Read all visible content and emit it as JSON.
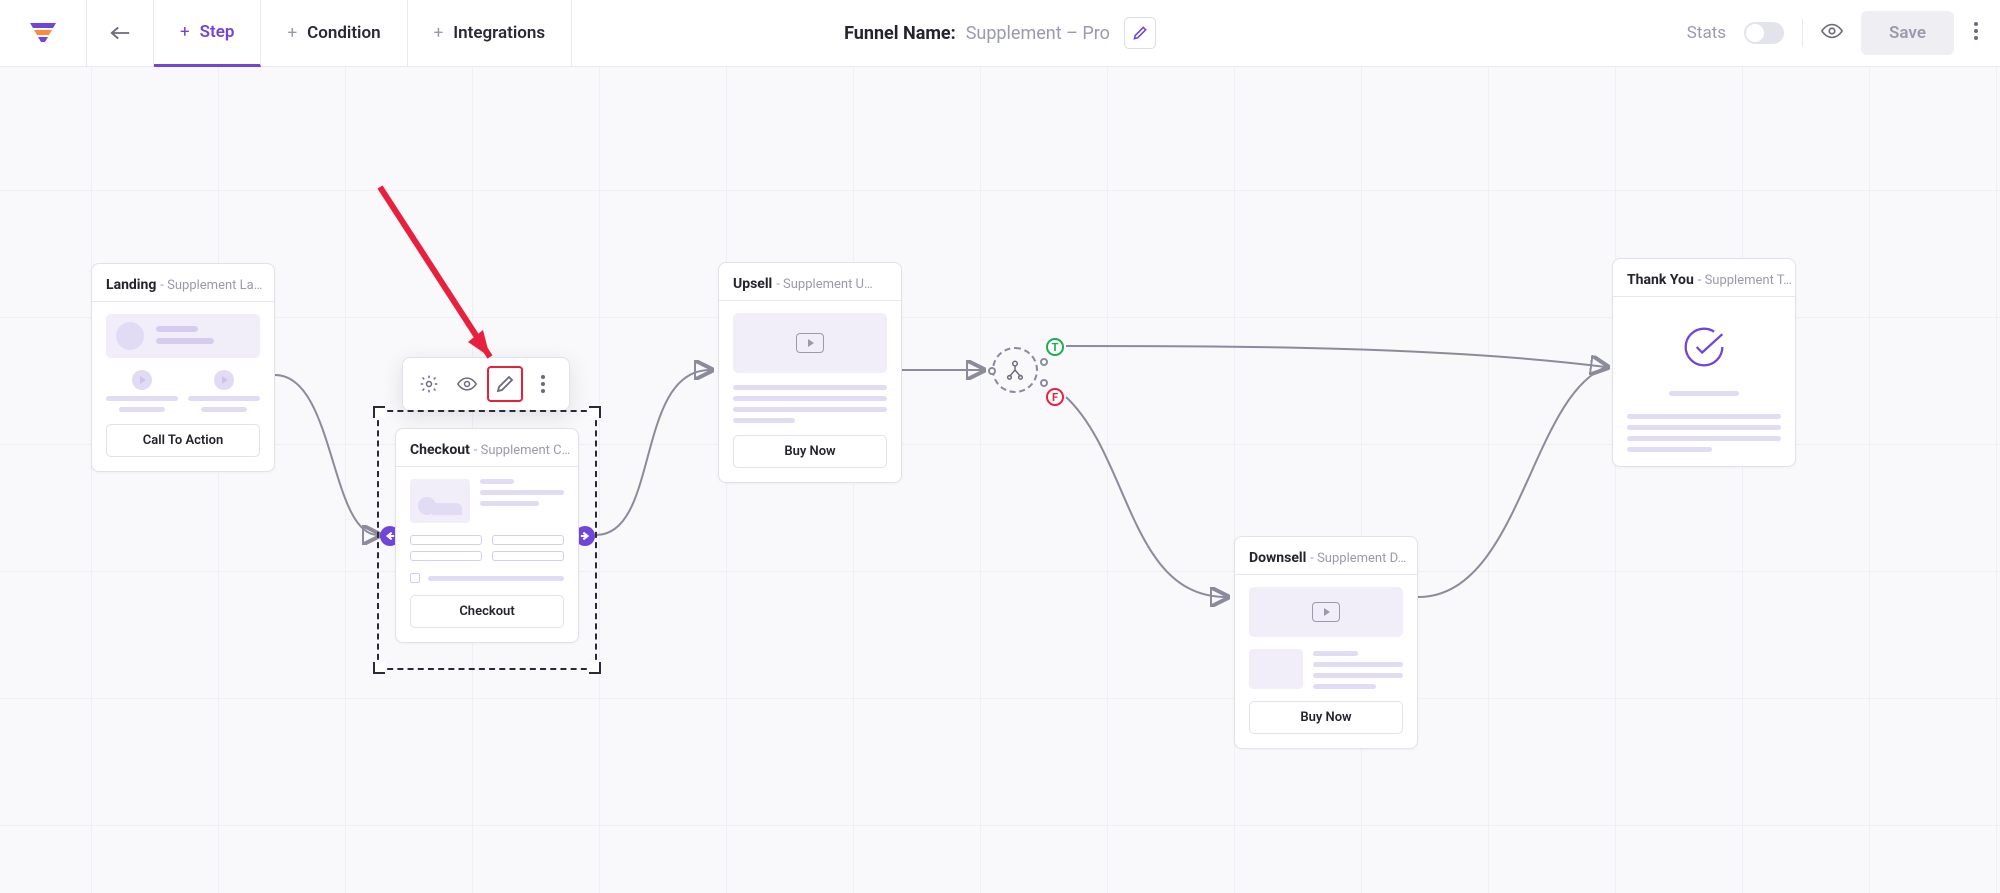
{
  "header": {
    "tabs": {
      "step": "Step",
      "condition": "Condition",
      "integrations": "Integrations"
    },
    "funnel_name_label": "Funnel Name:",
    "funnel_name_value": "Supplement – Pro",
    "stats_label": "Stats",
    "save_label": "Save"
  },
  "nodes": {
    "landing": {
      "title": "Landing",
      "sub": "- Supplement La…",
      "cta": "Call To Action"
    },
    "checkout": {
      "title": "Checkout",
      "sub": "- Supplement C…",
      "cta": "Checkout"
    },
    "upsell": {
      "title": "Upsell",
      "sub": "- Supplement U…",
      "cta": "Buy Now"
    },
    "downsell": {
      "title": "Downsell",
      "sub": "- Supplement D…",
      "cta": "Buy Now"
    },
    "thankyou": {
      "title": "Thank You",
      "sub": "- Supplement T…"
    }
  },
  "condition": {
    "true_label": "T",
    "false_label": "F"
  },
  "colors": {
    "accent": "#7245da",
    "true": "#17b04e",
    "false": "#e9203d",
    "arrow": "#e9203d"
  }
}
